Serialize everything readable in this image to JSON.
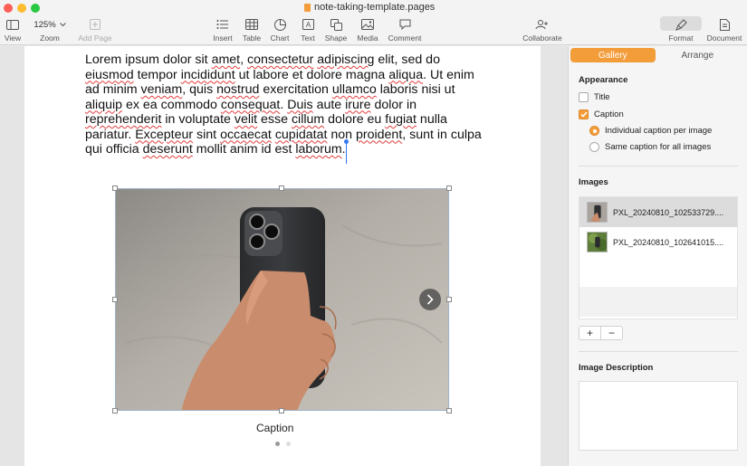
{
  "window": {
    "title": "note-taking-template.pages"
  },
  "toolbar": {
    "view": "View",
    "zoom_value": "125%",
    "zoom": "Zoom",
    "add_page": "Add Page",
    "insert": "Insert",
    "table": "Table",
    "chart": "Chart",
    "text": "Text",
    "shape": "Shape",
    "media": "Media",
    "comment": "Comment",
    "collaborate": "Collaborate",
    "format": "Format",
    "document": "Document"
  },
  "document": {
    "paragraph": [
      {
        "t": "Lorem ipsum dolor sit "
      },
      {
        "t": "amet",
        "s": true
      },
      {
        "t": ", "
      },
      {
        "t": "consectetur",
        "s": true
      },
      {
        "t": " "
      },
      {
        "t": "adipiscing",
        "s": true
      },
      {
        "t": " elit, sed do "
      },
      {
        "t": "eiusmod",
        "s": true
      },
      {
        "t": " tempor "
      },
      {
        "t": "incididunt",
        "s": true
      },
      {
        "t": " ut labore et dolore magna "
      },
      {
        "t": "aliqua",
        "s": true
      },
      {
        "t": ". Ut enim ad minim "
      },
      {
        "t": "veniam",
        "s": true
      },
      {
        "t": ", quis "
      },
      {
        "t": "nostrud",
        "s": true
      },
      {
        "t": " exercitation "
      },
      {
        "t": "ullamco",
        "s": true
      },
      {
        "t": " laboris nisi ut "
      },
      {
        "t": "aliquip",
        "s": true
      },
      {
        "t": " ex ea commodo "
      },
      {
        "t": "consequat",
        "s": true
      },
      {
        "t": ". "
      },
      {
        "t": "Duis",
        "s": true
      },
      {
        "t": " aute "
      },
      {
        "t": "irure",
        "s": true
      },
      {
        "t": " dolor in "
      },
      {
        "t": "reprehenderit",
        "s": true
      },
      {
        "t": " in voluptate "
      },
      {
        "t": "velit",
        "s": true
      },
      {
        "t": " esse "
      },
      {
        "t": "cillum",
        "s": true
      },
      {
        "t": " dolore eu "
      },
      {
        "t": "fugiat",
        "s": true
      },
      {
        "t": " nulla pariatur. "
      },
      {
        "t": "Excepteur",
        "s": true
      },
      {
        "t": " sint "
      },
      {
        "t": "occaecat",
        "s": true
      },
      {
        "t": " "
      },
      {
        "t": "cupidatat",
        "s": true
      },
      {
        "t": " non "
      },
      {
        "t": "proident",
        "s": true
      },
      {
        "t": ", sunt in culpa qui officia "
      },
      {
        "t": "deserunt",
        "s": true
      },
      {
        "t": " mollit anim id est "
      },
      {
        "t": "laborum",
        "s": true
      },
      {
        "t": "."
      }
    ],
    "caption": "Caption"
  },
  "sidebar": {
    "tabs": {
      "gallery": "Gallery",
      "arrange": "Arrange"
    },
    "appearance": {
      "title": "Appearance",
      "title_option": "Title",
      "caption_option": "Caption",
      "individual_caption": "Individual caption per image",
      "same_caption": "Same caption for all images"
    },
    "images": {
      "title": "Images",
      "items": [
        "PXL_20240810_102533729....",
        "PXL_20240810_102641015...."
      ]
    },
    "image_description": {
      "title": "Image Description"
    }
  },
  "colors": {
    "accent": "#f39c3a",
    "selection": "#3478f6"
  }
}
